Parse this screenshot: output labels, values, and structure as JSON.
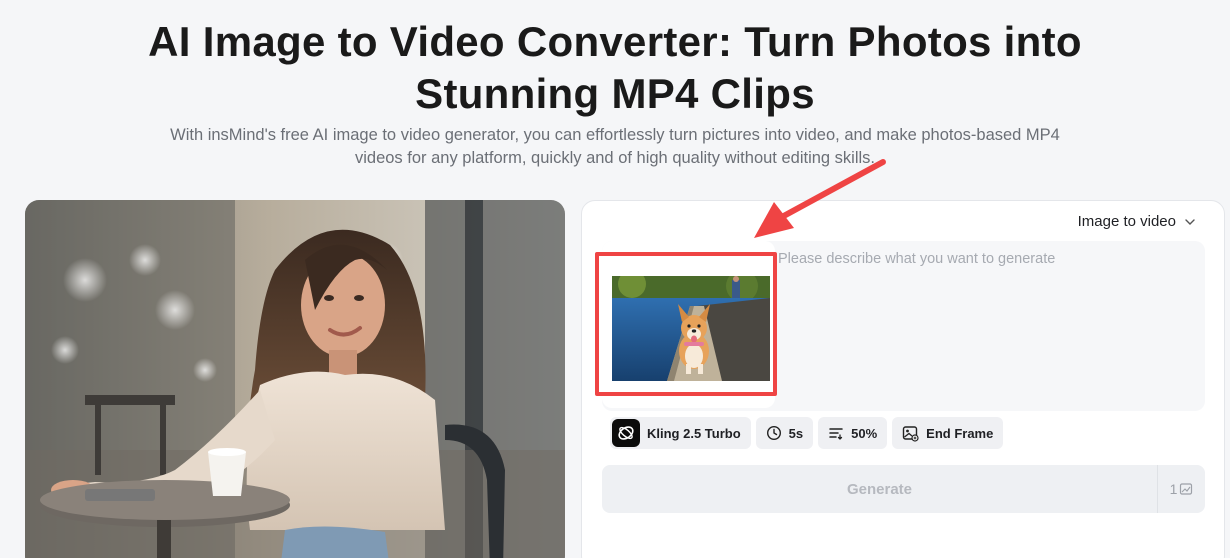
{
  "hero": {
    "title": "AI Image to Video Converter: Turn Photos into Stunning MP4 Clips",
    "title_line1": "AI Image to Video Converter: Turn Photos into",
    "title_line2": "Stunning MP4 Clips",
    "subtitle_line1": "With insMind's free AI image to video generator, you can effortlessly turn pictures into video, and make photos-based MP4",
    "subtitle_line2": "videos for any platform, quickly and of high quality without editing skills."
  },
  "panel": {
    "mode_label": "Image to video",
    "prompt_placeholder": "Please describe what you want to generate",
    "options": {
      "model": "Kling 2.5 Turbo",
      "duration": "5s",
      "strength": "50%",
      "end_frame": "End Frame"
    },
    "generate_label": "Generate",
    "cost": "1"
  },
  "icons": {
    "mode_chevron": "chevron-down-icon",
    "model_logo": "kling-logo-icon",
    "duration": "clock-icon",
    "strength": "sliders-icon",
    "end_frame": "image-frame-icon",
    "cost": "credit-icon"
  },
  "colors": {
    "highlight": "#ef4444",
    "background": "#f5f6f8",
    "panel": "#ffffff",
    "generate_disabled_text": "#b6b9bf"
  }
}
